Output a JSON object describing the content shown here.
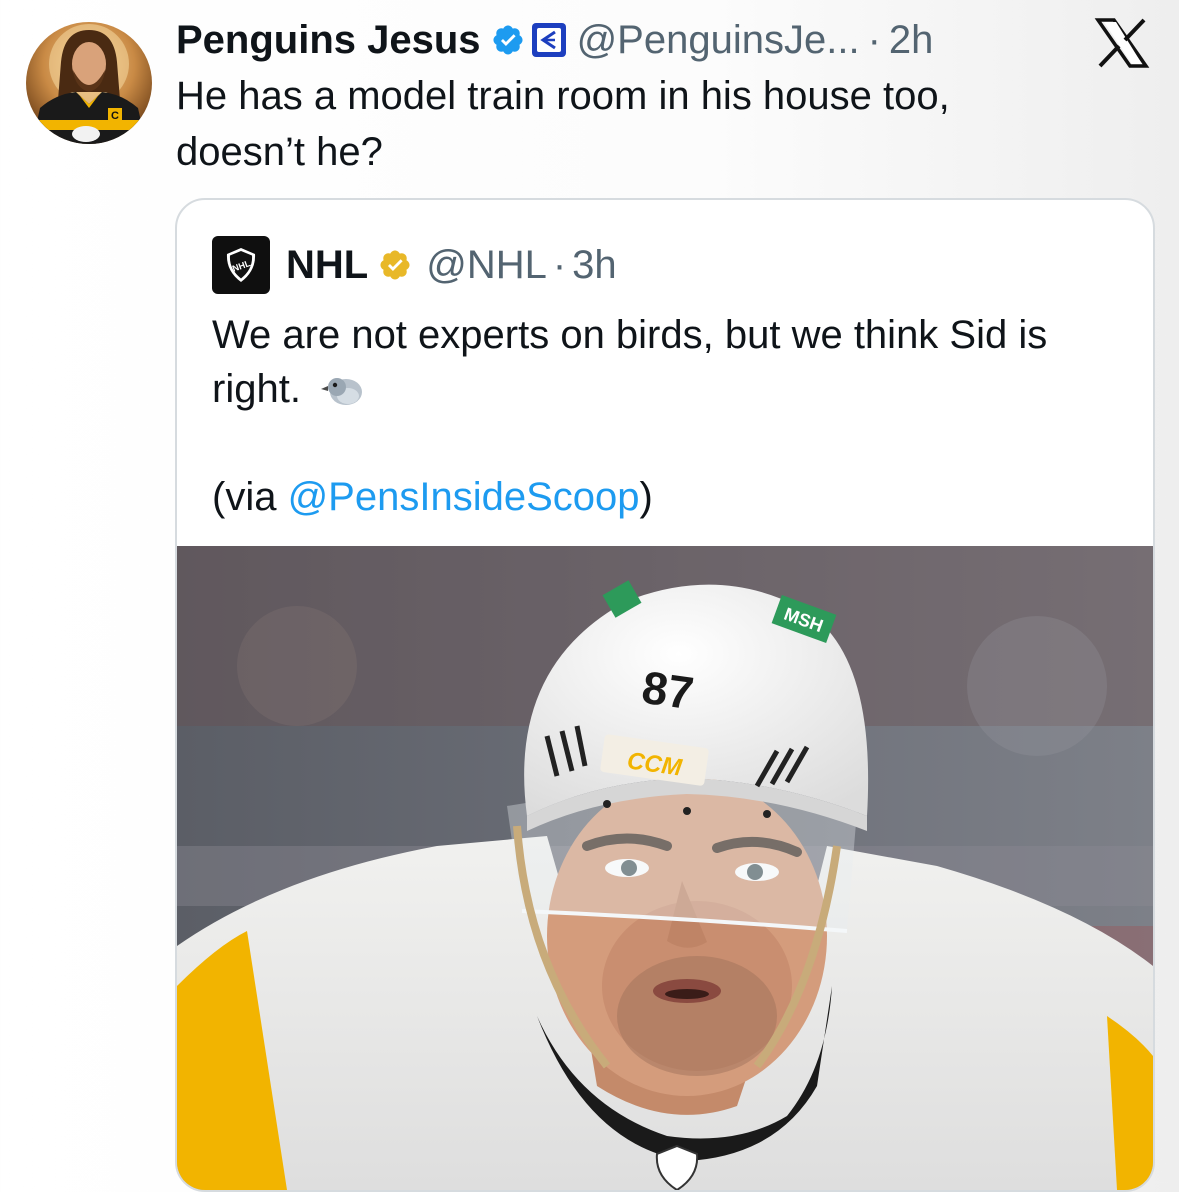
{
  "tweet": {
    "display_name": "Penguins Jesus",
    "handle": "@PenguinsJe...",
    "separator": "·",
    "time": "2h",
    "text": "He has a model train room in his house too, doesn’t he?",
    "avatar_icon": "avatar-image",
    "verified_icon": "verified-badge-icon",
    "affiliate_icon": "affiliate-badge-icon",
    "brand_icon": "x-logo-icon"
  },
  "quote": {
    "display_name": "NHL",
    "handle": "@NHL",
    "separator": "·",
    "time": "3h",
    "text": "We are not experts on birds, but we think Sid is right.",
    "emoji": "bird-emoji-icon",
    "via_prefix": "(via ",
    "via_mention": "@PensInsideScoop",
    "via_suffix": ")",
    "avatar_icon": "nhl-logo-icon",
    "verified_icon": "gold-verified-badge-icon",
    "media": {
      "jersey_number": "87",
      "helmet_brand": "CCM",
      "sticker_text": "MSH"
    }
  },
  "colors": {
    "text": "#0f1419",
    "secondary": "#536471",
    "link": "#1d9bf0",
    "verified_blue": "#1d9bf0",
    "verified_gold": "#e8b828",
    "card_border": "#d6dbdf"
  }
}
